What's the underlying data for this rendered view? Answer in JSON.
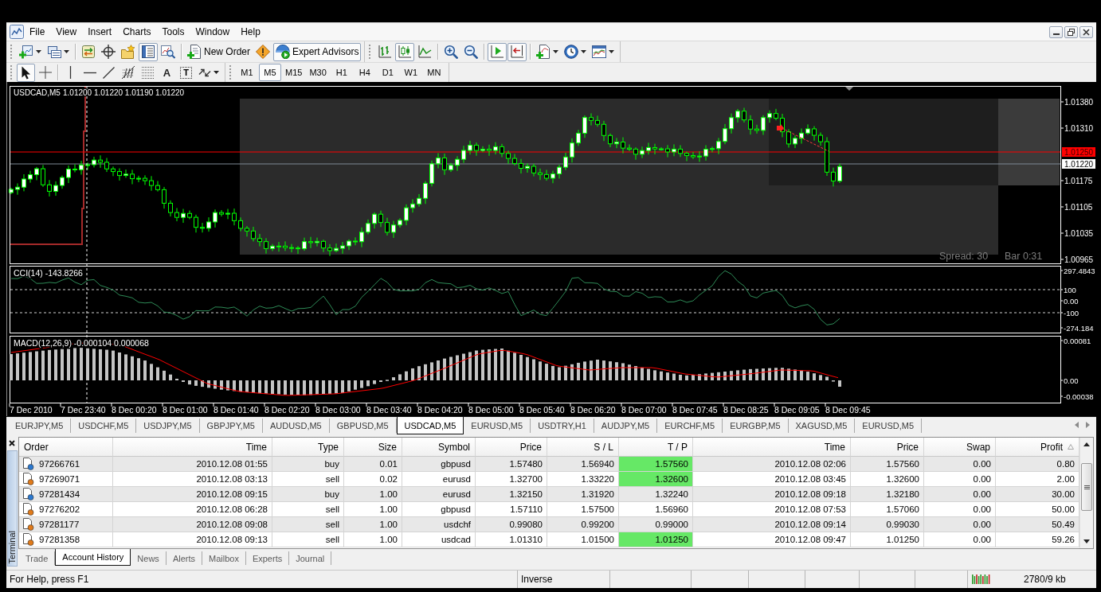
{
  "menu": [
    "File",
    "View",
    "Insert",
    "Charts",
    "Tools",
    "Window",
    "Help"
  ],
  "toolbar_standard": {
    "groups": [
      [
        {
          "kind": "new_chart",
          "pressed": false
        },
        {
          "kind": "profiles",
          "pressed": false
        }
      ],
      [
        {
          "kind": "market_watch",
          "pressed": false
        },
        {
          "kind": "data_window",
          "pressed": false
        },
        {
          "kind": "navigator",
          "pressed": false
        },
        {
          "kind": "terminal",
          "pressed": true
        },
        {
          "kind": "tester",
          "pressed": false
        }
      ],
      [
        {
          "kind": "new_order",
          "label": "New Order",
          "pressed": false
        },
        {
          "kind": "metaeditor",
          "pressed": false
        },
        {
          "kind": "expert_advisors",
          "label": "Expert Advisors",
          "pressed": true
        }
      ]
    ]
  },
  "toolbar_charts": {
    "groups": [
      [
        {
          "kind": "bar_chart",
          "pressed": false
        },
        {
          "kind": "candlesticks",
          "pressed": true
        },
        {
          "kind": "line_chart",
          "pressed": false
        }
      ],
      [
        {
          "kind": "zoom_in",
          "pressed": false
        },
        {
          "kind": "zoom_out",
          "pressed": false
        }
      ],
      [
        {
          "kind": "auto_scroll",
          "pressed": true
        },
        {
          "kind": "chart_shift",
          "pressed": true
        }
      ],
      [
        {
          "kind": "indicators",
          "pressed": false
        },
        {
          "kind": "periods",
          "pressed": false
        },
        {
          "kind": "templates",
          "pressed": false
        }
      ]
    ]
  },
  "toolbar_objects": {
    "groups": [
      [
        {
          "kind": "cursor",
          "pressed": true
        },
        {
          "kind": "crosshair",
          "pressed": false
        }
      ],
      [
        {
          "kind": "vertical_line",
          "pressed": false
        },
        {
          "kind": "horizontal_line",
          "pressed": false
        },
        {
          "kind": "trendline",
          "pressed": false
        },
        {
          "kind": "fibonacci",
          "pressed": false
        },
        {
          "kind": "grid",
          "pressed": false
        },
        {
          "kind": "text",
          "label": "A",
          "pressed": false
        },
        {
          "kind": "text_label",
          "label": "T",
          "pressed": false
        },
        {
          "kind": "arrows",
          "pressed": false
        }
      ]
    ]
  },
  "timeframes": [
    {
      "label": "M1",
      "selected": false
    },
    {
      "label": "M5",
      "selected": true
    },
    {
      "label": "M15",
      "selected": false
    },
    {
      "label": "M30",
      "selected": false
    },
    {
      "label": "H1",
      "selected": false
    },
    {
      "label": "H4",
      "selected": false
    },
    {
      "label": "D1",
      "selected": false
    },
    {
      "label": "W1",
      "selected": false
    },
    {
      "label": "MN",
      "selected": false
    }
  ],
  "chart": {
    "symbol": "USDCAD,M5",
    "quotes": "1.01200 1.01220 1.01190 1.01220",
    "price_ticks": [
      "1.01380",
      "1.01310",
      "1.01175",
      "1.01105",
      "1.01035",
      "1.00965"
    ],
    "price_markers": [
      {
        "kind": "take_profit",
        "label": "1.01250"
      },
      {
        "kind": "bid",
        "label": "1.01220"
      }
    ],
    "spread": "Spread: 30",
    "bar_timer": "Bar 0:31",
    "time_labels": [
      "7 Dec 2010",
      "7 Dec 23:40",
      "8 Dec 00:20",
      "8 Dec 01:00",
      "8 Dec 01:40",
      "8 Dec 02:20",
      "8 Dec 03:00",
      "8 Dec 03:40",
      "8 Dec 04:20",
      "8 Dec 05:00",
      "8 Dec 05:40",
      "8 Dec 06:20",
      "8 Dec 07:00",
      "8 Dec 07:45",
      "8 Dec 08:25",
      "8 Dec 09:05",
      "8 Dec 09:45"
    ],
    "cci": {
      "title": "CCI(14) -143.8266",
      "ticks": [
        "297.4843",
        "100",
        "0.00",
        "-100",
        "-274.184"
      ]
    },
    "macd": {
      "title": "MACD(12,26,9) -0.000104 0.000068",
      "ticks": [
        "0.00081",
        "0.00",
        "-0.00038"
      ]
    }
  },
  "chart_tabs": [
    {
      "label": "EURJPY,M5",
      "selected": false
    },
    {
      "label": "USDCHF,M5",
      "selected": false
    },
    {
      "label": "USDJPY,M5",
      "selected": false
    },
    {
      "label": "GBPJPY,M5",
      "selected": false
    },
    {
      "label": "AUDUSD,M5",
      "selected": false
    },
    {
      "label": "GBPUSD,M5",
      "selected": false
    },
    {
      "label": "USDCAD,M5",
      "selected": true
    },
    {
      "label": "EURUSD,M5",
      "selected": false
    },
    {
      "label": "USDTRY,H1",
      "selected": false
    },
    {
      "label": "AUDJPY,M5",
      "selected": false
    },
    {
      "label": "EURCHF,M5",
      "selected": false
    },
    {
      "label": "EURGBP,M5",
      "selected": false
    },
    {
      "label": "XAGUSD,M5",
      "selected": false
    },
    {
      "label": "EURUSD,M5",
      "selected": false
    }
  ],
  "terminal": {
    "title": "Terminal",
    "columns": [
      {
        "label": "Order",
        "sorted": false
      },
      {
        "label": "Time",
        "sorted": false
      },
      {
        "label": "Type",
        "sorted": false
      },
      {
        "label": "Size",
        "sorted": false
      },
      {
        "label": "Symbol",
        "sorted": false
      },
      {
        "label": "Price",
        "sorted": false
      },
      {
        "label": "S / L",
        "sorted": false
      },
      {
        "label": "T / P",
        "sorted": false
      },
      {
        "label": "Time",
        "sorted": false
      },
      {
        "label": "Price",
        "sorted": false
      },
      {
        "label": "Swap",
        "sorted": false
      },
      {
        "label": "Profit",
        "sorted": true
      }
    ],
    "rows": [
      {
        "kind": "buy",
        "tp_highlighted": true,
        "cells": [
          "97266761",
          "2010.12.08 01:55",
          "buy",
          "0.01",
          "gbpusd",
          "1.57480",
          "1.56940",
          "1.57560",
          "2010.12.08 02:06",
          "1.57560",
          "0.00",
          "0.80"
        ]
      },
      {
        "kind": "sell",
        "tp_highlighted": true,
        "cells": [
          "97269071",
          "2010.12.08 03:13",
          "sell",
          "0.02",
          "eurusd",
          "1.32700",
          "1.33220",
          "1.32600",
          "2010.12.08 03:45",
          "1.32600",
          "0.00",
          "2.00"
        ]
      },
      {
        "kind": "buy",
        "tp_highlighted": false,
        "cells": [
          "97281434",
          "2010.12.08 09:15",
          "buy",
          "1.00",
          "eurusd",
          "1.32150",
          "1.31920",
          "1.32240",
          "2010.12.08 09:18",
          "1.32180",
          "0.00",
          "30.00"
        ]
      },
      {
        "kind": "sell",
        "tp_highlighted": false,
        "cells": [
          "97276202",
          "2010.12.08 06:28",
          "sell",
          "1.00",
          "gbpusd",
          "1.57110",
          "1.57500",
          "1.56960",
          "2010.12.08 07:53",
          "1.57060",
          "0.00",
          "50.00"
        ]
      },
      {
        "kind": "sell",
        "tp_highlighted": false,
        "cells": [
          "97281177",
          "2010.12.08 09:08",
          "sell",
          "1.00",
          "usdchf",
          "0.99080",
          "0.99200",
          "0.99000",
          "2010.12.08 09:14",
          "0.99030",
          "0.00",
          "50.49"
        ]
      },
      {
        "kind": "sell",
        "tp_highlighted": true,
        "cells": [
          "97281358",
          "2010.12.08 09:13",
          "sell",
          "1.00",
          "usdcad",
          "1.01310",
          "1.01500",
          "1.01250",
          "2010.12.08 09:47",
          "1.01250",
          "0.00",
          "59.26"
        ]
      }
    ],
    "tabs": [
      {
        "label": "Trade",
        "selected": false
      },
      {
        "label": "Account History",
        "selected": true
      },
      {
        "label": "News",
        "selected": false
      },
      {
        "label": "Alerts",
        "selected": false
      },
      {
        "label": "Mailbox",
        "selected": false
      },
      {
        "label": "Experts",
        "selected": false
      },
      {
        "label": "Journal",
        "selected": false
      }
    ]
  },
  "status_bar": {
    "help": "For Help, press F1",
    "mode": "Inverse",
    "traffic": "2780/9 kb"
  }
}
